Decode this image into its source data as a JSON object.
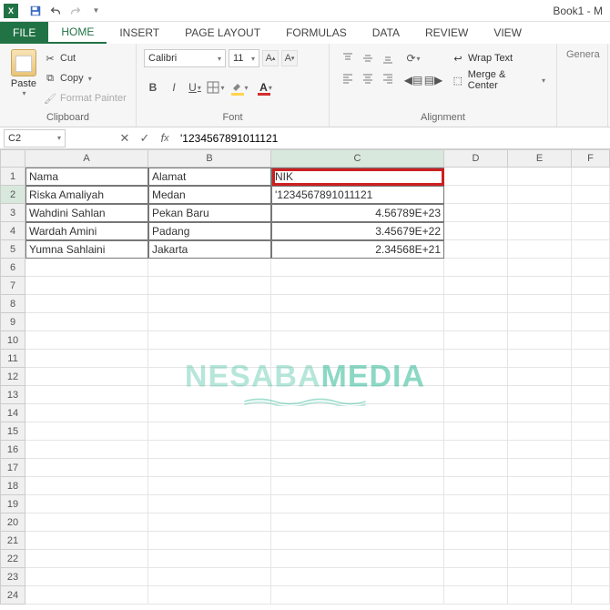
{
  "window": {
    "title": "Book1 - M"
  },
  "tabs": {
    "file": "FILE",
    "home": "HOME",
    "insert": "INSERT",
    "page_layout": "PAGE LAYOUT",
    "formulas": "FORMULAS",
    "data": "DATA",
    "review": "REVIEW",
    "view": "VIEW"
  },
  "ribbon": {
    "paste": "Paste",
    "cut": "Cut",
    "copy": "Copy",
    "format_painter": "Format Painter",
    "clipboard_group": "Clipboard",
    "font_name": "Calibri",
    "font_size": "11",
    "font_group": "Font",
    "wrap_text": "Wrap Text",
    "merge_center": "Merge & Center",
    "alignment_group": "Alignment",
    "number_format": "Genera"
  },
  "formula_bar": {
    "name_box": "C2",
    "formula": "'1234567891011121"
  },
  "columns": [
    "A",
    "B",
    "C",
    "D",
    "E",
    "F"
  ],
  "headers": {
    "a": "Nama",
    "b": "Alamat",
    "c": "NIK"
  },
  "rows": {
    "2": {
      "a": "Riska Amaliyah",
      "b": "Medan",
      "c": "'1234567891011121"
    },
    "3": {
      "a": "Wahdini Sahlan",
      "b": "Pekan Baru",
      "c": "4.56789E+23"
    },
    "4": {
      "a": "Wardah Amini",
      "b": "Padang",
      "c": "3.45679E+22"
    },
    "5": {
      "a": "Yumna Sahlaini",
      "b": "Jakarta",
      "c": "2.34568E+21"
    }
  },
  "watermark": {
    "part1": "NESABA",
    "part2": "MEDIA"
  }
}
